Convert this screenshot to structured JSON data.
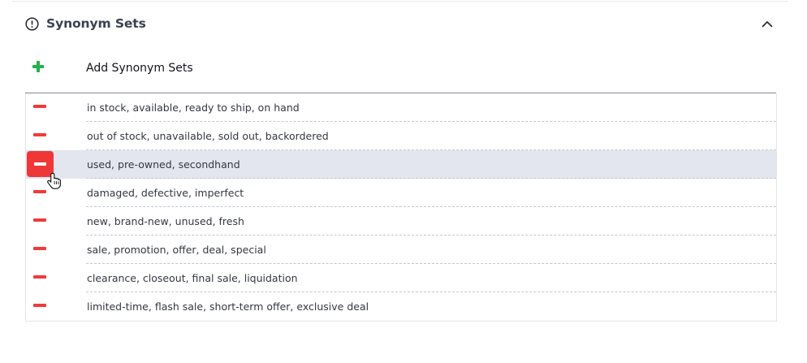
{
  "section": {
    "title": "Synonym Sets",
    "info_icon": "info-circle-icon",
    "toggle_icon": "chevron-up-icon"
  },
  "add": {
    "label": "Add Synonym Sets",
    "icon": "plus-icon",
    "color": "#22b14c"
  },
  "synonym_sets": [
    "in stock, available, ready to ship, on hand",
    "out of stock, unavailable, sold out, backordered",
    "used, pre-owned, secondhand",
    "damaged, defective, imperfect",
    "new, brand-new, unused, fresh",
    "sale, promotion, offer, deal, special",
    "clearance, closeout, final sale, liquidation",
    "limited-time, flash sale, short-term offer, exclusive deal"
  ],
  "highlighted_row": 2,
  "colors": {
    "remove": "#ef3b3b",
    "highlight": "#e3e6ee",
    "add": "#22b14c"
  }
}
